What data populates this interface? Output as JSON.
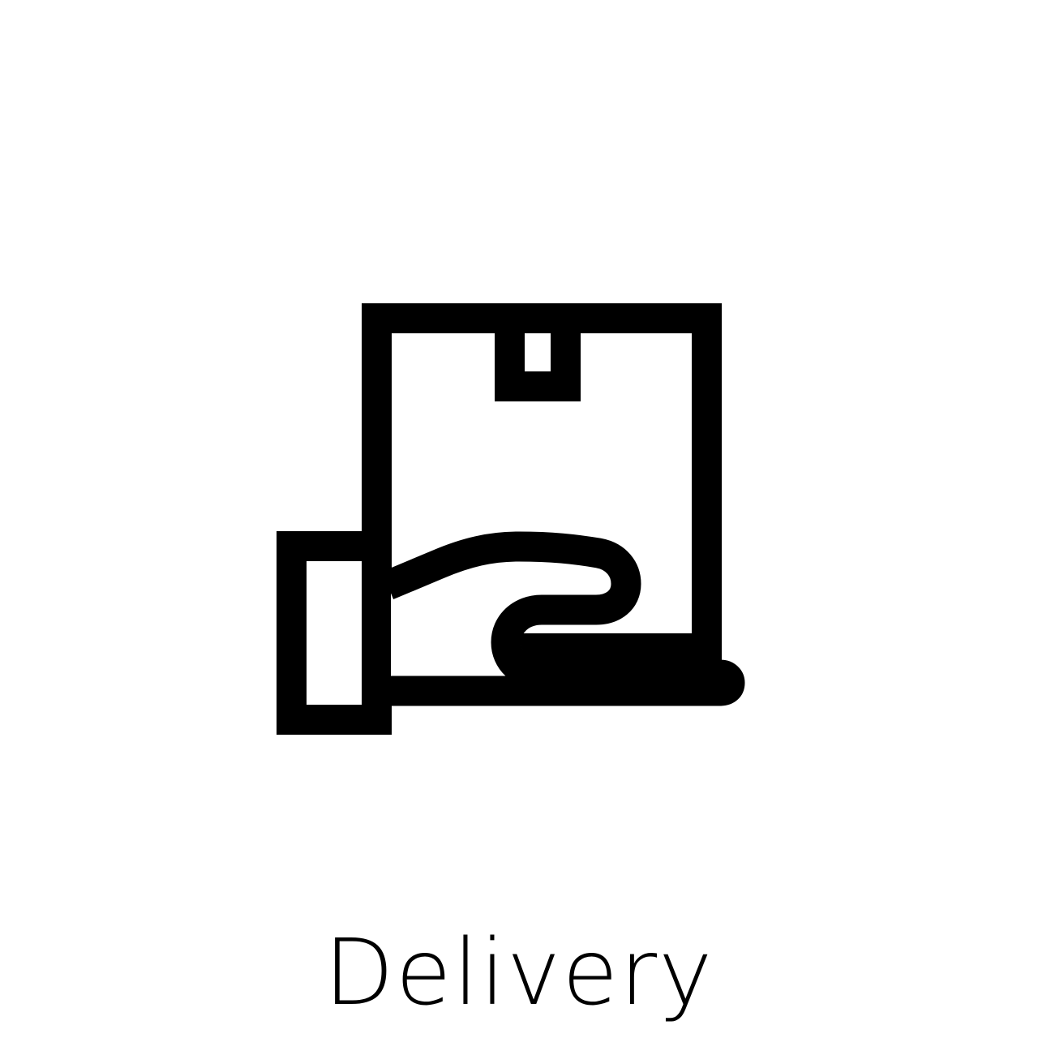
{
  "icon": {
    "name": "delivery-box-hand-icon",
    "color": "#000000"
  },
  "caption": {
    "text": "Delivery"
  },
  "background_color": "#ffffff"
}
